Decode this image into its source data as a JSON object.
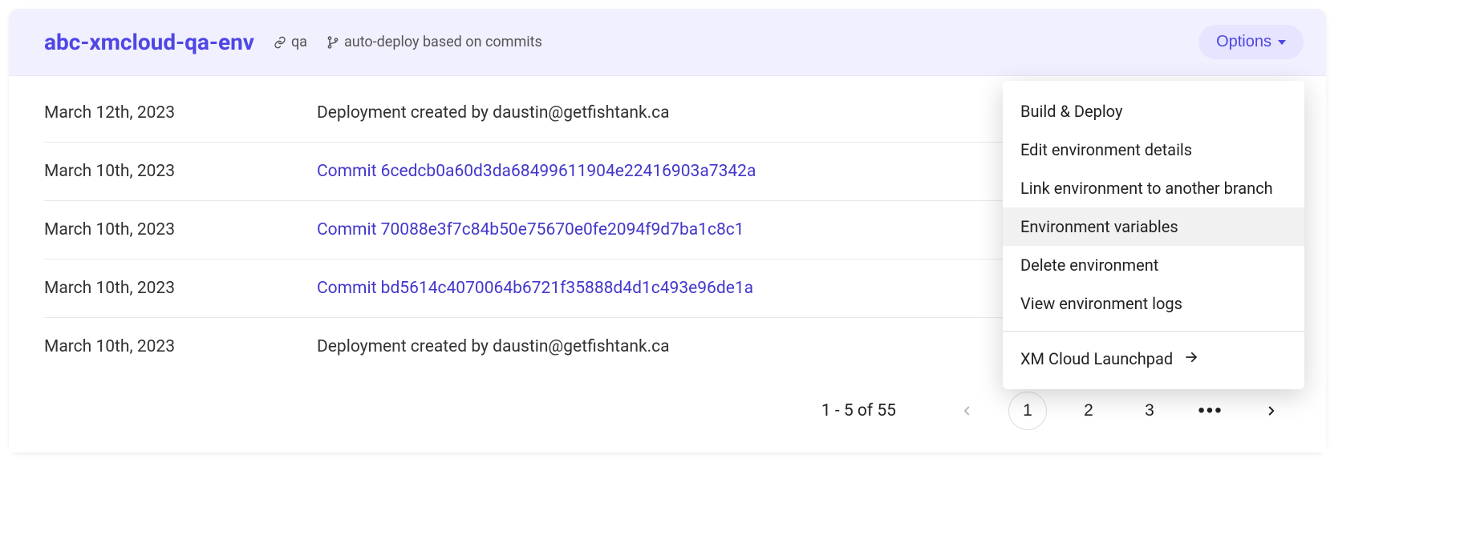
{
  "header": {
    "title": "abc-xmcloud-qa-env",
    "tag": "qa",
    "deploy_mode": "auto-deploy based on commits",
    "options_label": "Options"
  },
  "rows": [
    {
      "date": "March 12th, 2023",
      "kind": "text",
      "text": "Deployment created by daustin@getfishtank.ca"
    },
    {
      "date": "March 10th, 2023",
      "kind": "link",
      "text": "Commit 6cedcb0a60d3da68499611904e22416903a7342a"
    },
    {
      "date": "March 10th, 2023",
      "kind": "link",
      "text": "Commit 70088e3f7c84b50e75670e0fe2094f9d7ba1c8c1"
    },
    {
      "date": "March 10th, 2023",
      "kind": "link",
      "text": "Commit bd5614c4070064b6721f35888d4d1c493e96de1a"
    },
    {
      "date": "March 10th, 2023",
      "kind": "text",
      "text": "Deployment created by daustin@getfishtank.ca"
    }
  ],
  "dropdown": {
    "items": [
      {
        "label": "Build & Deploy",
        "highlight": false
      },
      {
        "label": "Edit environment details",
        "highlight": false
      },
      {
        "label": "Link environment to another branch",
        "highlight": false
      },
      {
        "label": "Environment variables",
        "highlight": true
      },
      {
        "label": "Delete environment",
        "highlight": false
      },
      {
        "label": "View environment logs",
        "highlight": false
      }
    ],
    "launchpad": "XM Cloud Launchpad"
  },
  "pagination": {
    "range": "1 - 5 of 55",
    "pages": [
      "1",
      "2",
      "3"
    ],
    "current": "1",
    "ellipsis": "•••"
  }
}
